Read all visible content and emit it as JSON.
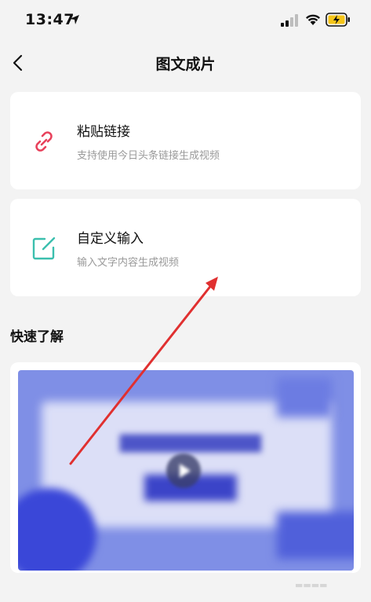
{
  "status_bar": {
    "time": "13:47"
  },
  "nav": {
    "title": "图文成片"
  },
  "cards": [
    {
      "title": "粘贴链接",
      "subtitle": "支持使用今日头条链接生成视频"
    },
    {
      "title": "自定义输入",
      "subtitle": "输入文字内容生成视频"
    }
  ],
  "section": {
    "title": "快速了解"
  },
  "icons": {
    "back": "chevron-left-icon",
    "link": "link-icon",
    "edit": "edit-icon",
    "play": "play-icon"
  },
  "colors": {
    "link_icon": "#e8415b",
    "edit_icon": "#3bbfae",
    "annotation_arrow": "#e03030"
  }
}
